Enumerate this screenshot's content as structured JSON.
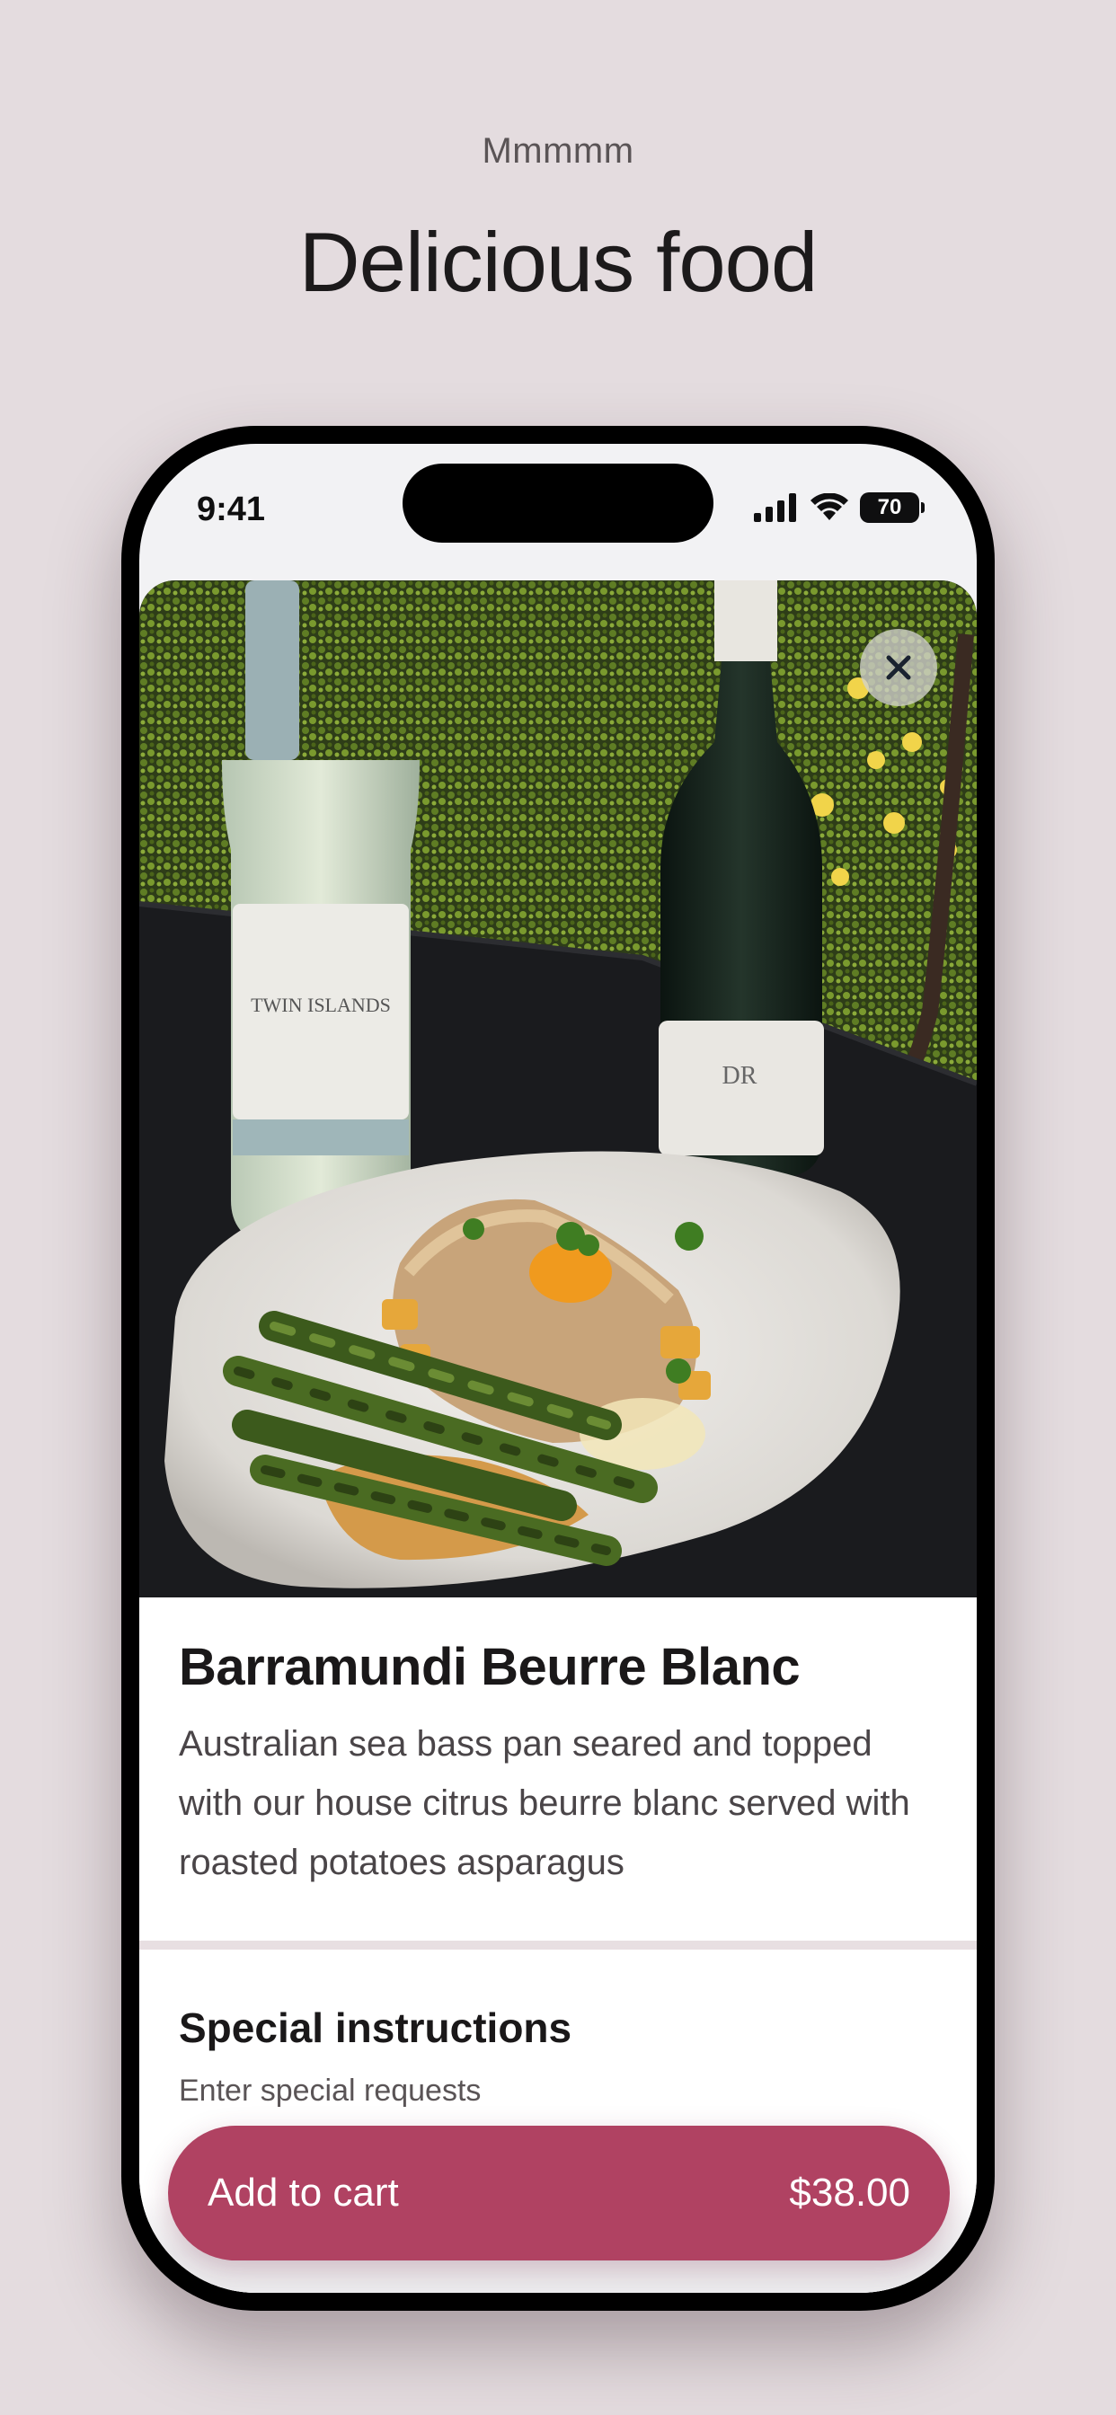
{
  "header": {
    "eyebrow": "Mmmmm",
    "headline": "Delicious food"
  },
  "status_bar": {
    "time": "9:41",
    "battery": "70",
    "icons": [
      "cellular-signal-icon",
      "wifi-icon",
      "battery-icon"
    ]
  },
  "item": {
    "photo_description": "plate-of-fish-with-asparagus-and-wine-bottles",
    "title": "Barramundi Beurre Blanc",
    "description": "Australian sea bass pan seared and topped with our house citrus beurre blanc served with roasted potatoes asparagus"
  },
  "special_instructions": {
    "title": "Special instructions",
    "placeholder": "Enter special requests",
    "value": ""
  },
  "cart_button": {
    "label": "Add to cart",
    "price": "$38.00"
  },
  "colors": {
    "background": "#e4dcdf",
    "accent": "#b04262",
    "text": "#1a1819"
  }
}
